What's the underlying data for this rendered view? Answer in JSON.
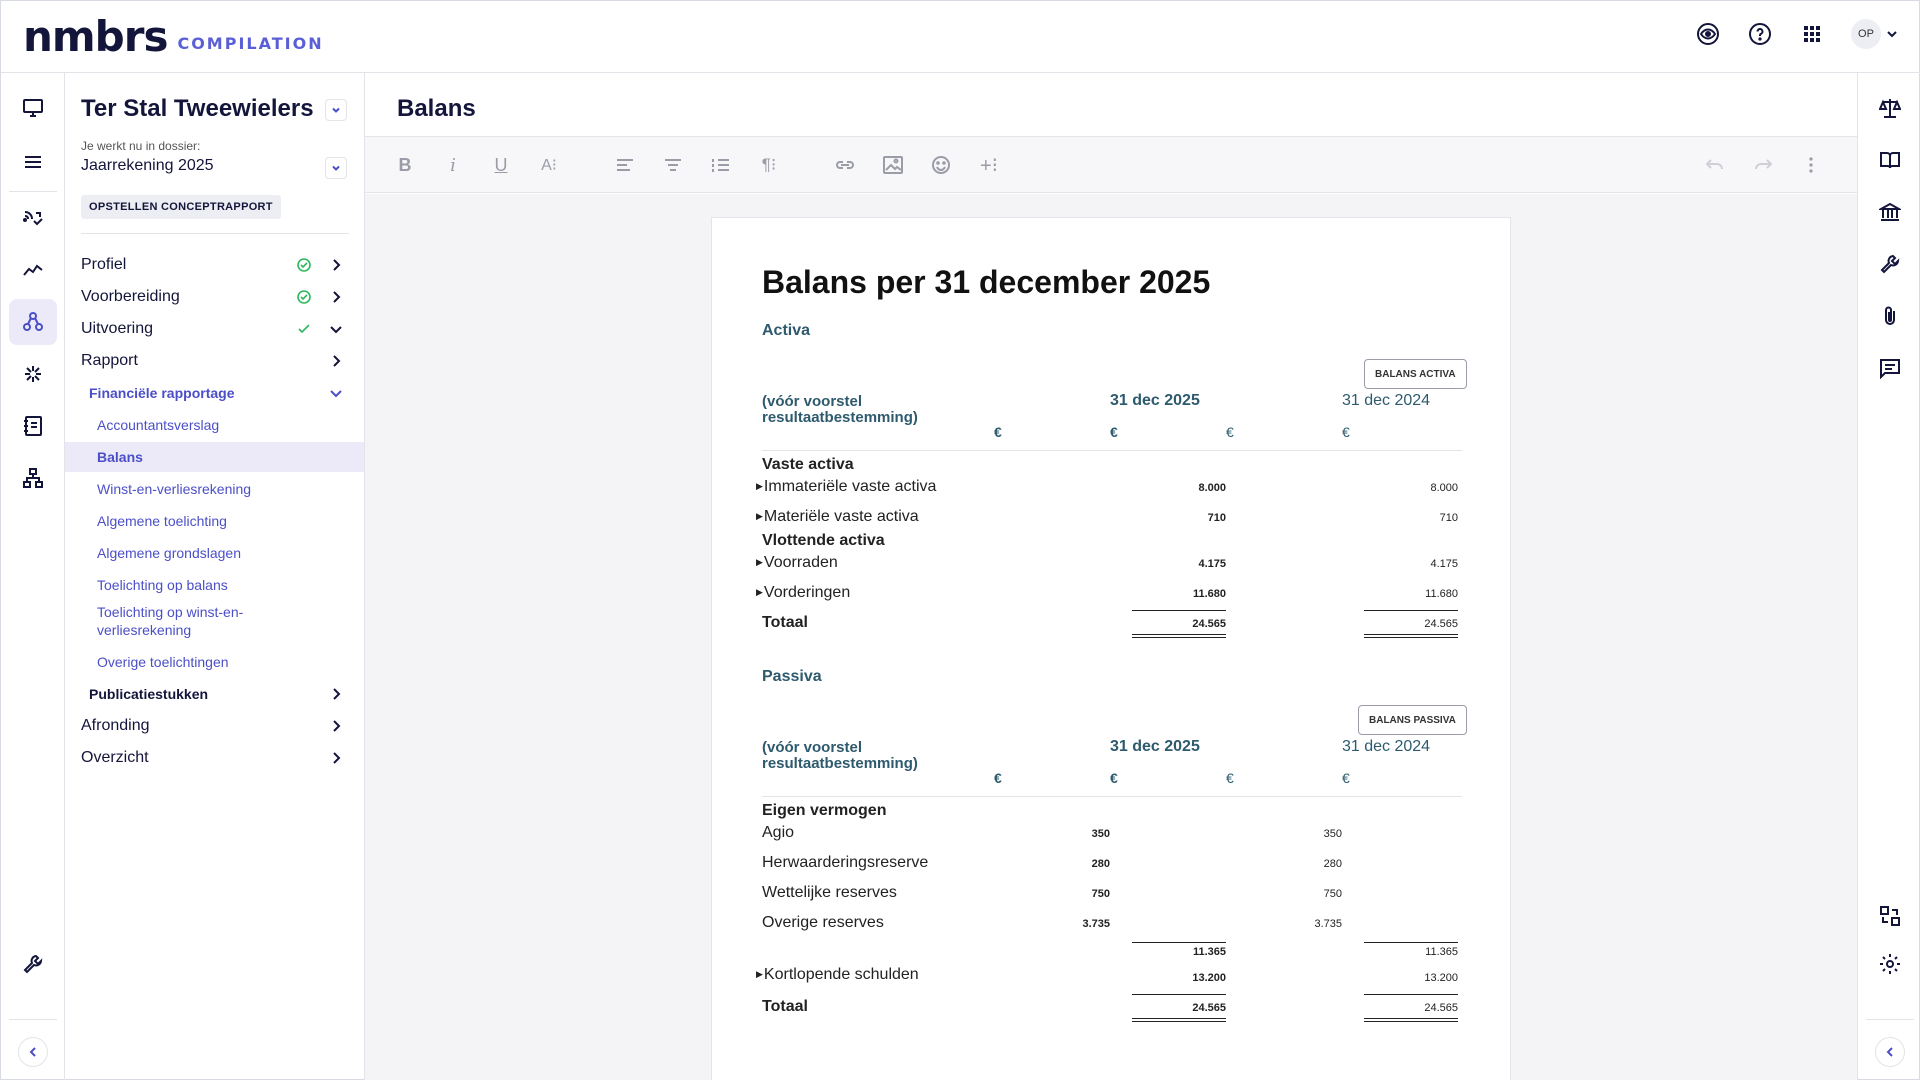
{
  "brand": {
    "logo": "nmbrs",
    "product": "COMPILATION"
  },
  "topbar": {
    "avatar_initials": "OP"
  },
  "sidebar": {
    "client_name": "Ter Stal Tweewielers",
    "dossier_label": "Je werkt nu in dossier:",
    "dossier_value": "Jaarrekening 2025",
    "status_badge": "OPSTELLEN CONCEPTRAPPORT",
    "items": [
      {
        "label": "Profiel",
        "status": "done"
      },
      {
        "label": "Voorbereiding",
        "status": "done"
      },
      {
        "label": "Uitvoering",
        "status": "checked"
      },
      {
        "label": "Rapport"
      },
      {
        "label": "Financiële rapportage"
      },
      {
        "label": "Accountantsverslag"
      },
      {
        "label": "Balans"
      },
      {
        "label": "Winst-en-verliesrekening"
      },
      {
        "label": "Algemene toelichting"
      },
      {
        "label": "Algemene grondslagen"
      },
      {
        "label": "Toelichting op balans"
      },
      {
        "label": "Toelichting op winst-en-"
      },
      {
        "label": "verliesrekening"
      },
      {
        "label": "Overige toelichtingen"
      },
      {
        "label": "Publicatiestukken"
      },
      {
        "label": "Afronding"
      },
      {
        "label": "Overzicht"
      }
    ]
  },
  "main": {
    "title": "Balans"
  },
  "document": {
    "title": "Balans per 31 december 2025",
    "activa": {
      "section": "Activa",
      "tag": "BALANS ACTIVA",
      "col_head_1": "(vóór voorstel",
      "col_head_2": "resultaatbestemming)",
      "date_current": "31 dec 2025",
      "date_previous": "31 dec 2024",
      "currency": "€",
      "group_fixed": "Vaste activa",
      "group_current": "Vlottende activa",
      "rows": [
        {
          "label": "Immateriële vaste activa",
          "current": "8.000",
          "previous": "8.000"
        },
        {
          "label": "Materiële vaste activa",
          "current": "710",
          "previous": "710"
        },
        {
          "label": "Voorraden",
          "current": "4.175",
          "previous": "4.175"
        },
        {
          "label": "Vorderingen",
          "current": "11.680",
          "previous": "11.680"
        }
      ],
      "total_label": "Totaal",
      "total_current": "24.565",
      "total_previous": "24.565"
    },
    "passiva": {
      "section": "Passiva",
      "tag": "BALANS PASSIVA",
      "col_head_1": "(vóór voorstel",
      "col_head_2": "resultaatbestemming)",
      "date_current": "31 dec 2025",
      "date_previous": "31 dec 2024",
      "currency": "€",
      "group_equity": "Eigen vermogen",
      "equity_rows": [
        {
          "label": "Agio",
          "current": "350",
          "previous": "350"
        },
        {
          "label": "Herwaarderingsreserve",
          "current": "280",
          "previous": "280"
        },
        {
          "label": "Wettelijke reserves",
          "current": "750",
          "previous": "750"
        },
        {
          "label": "Overige reserves",
          "current": "3.735",
          "previous": "3.735"
        }
      ],
      "equity_subtotal_current": "11.365",
      "equity_subtotal_previous": "11.365",
      "liabilities_label": "Kortlopende schulden",
      "liabilities_current": "13.200",
      "liabilities_previous": "13.200",
      "total_label": "Totaal",
      "total_current": "24.565",
      "total_previous": "24.565"
    }
  }
}
